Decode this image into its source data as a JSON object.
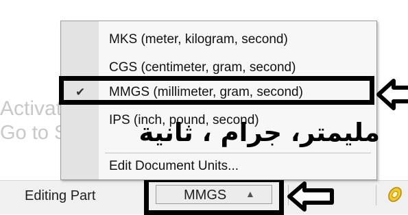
{
  "watermark": {
    "line1": "Activate Windows",
    "line2": "Go to Settings to activate Windows."
  },
  "status_bar": {
    "left_text": "Editing Part",
    "units_value": "MMGS",
    "caret": "▲",
    "pin_icon": "pin-icon"
  },
  "menu": {
    "items": [
      {
        "label": "MKS (meter, kilogram, second)",
        "checked": false
      },
      {
        "label": "CGS (centimeter, gram, second)",
        "checked": false
      },
      {
        "label": "MMGS (millimeter, gram, second)",
        "checked": true
      },
      {
        "label": "IPS (inch, pound, second)",
        "checked": false
      },
      {
        "label": "Edit Document Units...",
        "checked": false
      }
    ],
    "check_glyph": "✔"
  },
  "annotation": {
    "arabic_caption": "مليمتر، جرام ، ثانية"
  },
  "colors": {
    "highlight": "#000000",
    "menu_bg": "#f7f7f7",
    "status_bg": "#f0f0f0"
  }
}
